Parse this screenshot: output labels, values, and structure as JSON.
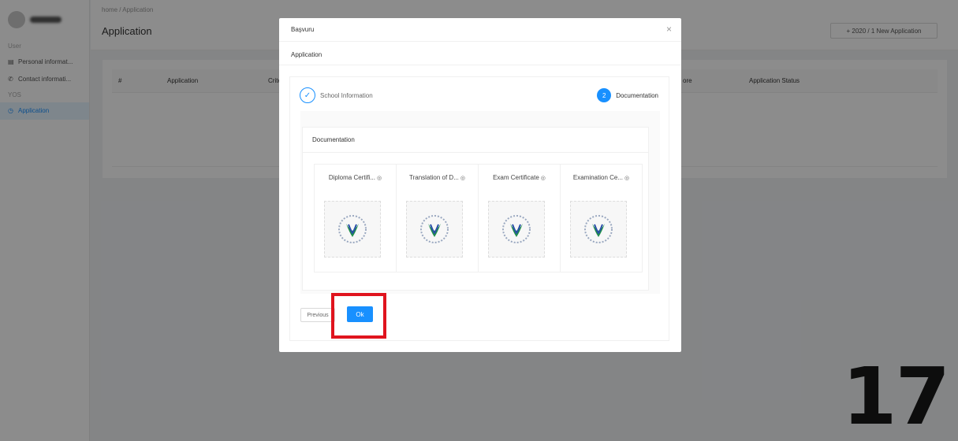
{
  "sidebar": {
    "group_user": "User",
    "items_user": [
      {
        "label": "Personal informat...",
        "icon": "id-card-icon"
      },
      {
        "label": "Contact informati...",
        "icon": "phone-icon"
      }
    ],
    "group_yos": "YOS",
    "items_yos": [
      {
        "label": "Application",
        "icon": "clock-icon",
        "active": true
      }
    ]
  },
  "header": {
    "breadcrumb": "home / Application",
    "title": "Application",
    "new_button": "+ 2020 / 1 New Application"
  },
  "table": {
    "columns": [
      "#",
      "Application",
      "Crite",
      "ore",
      "Application Status"
    ]
  },
  "modal": {
    "title": "Başvuru",
    "close": "×",
    "subtitle": "Application",
    "steps": [
      {
        "label": "School Information",
        "status": "done"
      },
      {
        "number": "2",
        "label": "Documentation",
        "status": "active"
      }
    ],
    "documentation_title": "Documentation",
    "documents": [
      {
        "label": "Diploma Certifi..."
      },
      {
        "label": "Translation of D..."
      },
      {
        "label": "Exam Certificate"
      },
      {
        "label": "Examination Ce..."
      }
    ],
    "previous_button": "Previous",
    "ok_button": "Ok"
  },
  "annotation": {
    "step_number": "17",
    "highlight_color": "#e0141e"
  },
  "colors": {
    "primary": "#1890ff"
  }
}
